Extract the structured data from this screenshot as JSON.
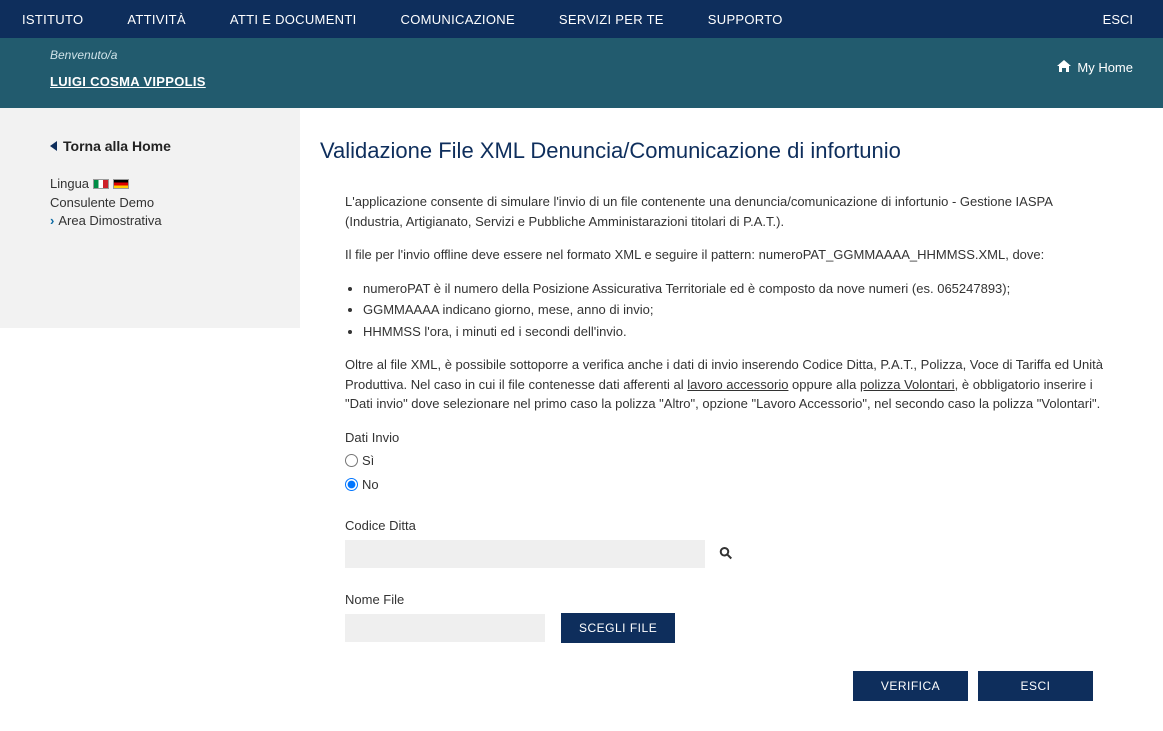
{
  "nav": {
    "items": [
      "ISTITUTO",
      "ATTIVITÀ",
      "ATTI E DOCUMENTI",
      "COMUNICAZIONE",
      "SERVIZI PER TE",
      "SUPPORTO"
    ],
    "exit": "ESCI"
  },
  "subheader": {
    "welcome": "Benvenuto/a",
    "user": "LUIGI COSMA VIPPOLIS",
    "myhome": "My Home"
  },
  "sidebar": {
    "back": "Torna alla Home",
    "lang_label": "Lingua",
    "consulente": "Consulente Demo",
    "area": "Area Dimostrativa"
  },
  "page": {
    "title": "Validazione File XML Denuncia/Comunicazione di infortunio",
    "intro1": "L'applicazione consente di simulare l'invio di un file contenente una denuncia/comunicazione di infortunio - Gestione IASPA (Industria, Artigianato, Servizi e Pubbliche Amministarazioni titolari di P.A.T.).",
    "intro2_pre": "Il file per l'invio offline deve essere nel formato XML e seguire il pattern:    ",
    "intro2_pattern": "numeroPAT_GGMMAAAA_HHMMSS.XML, dove:",
    "bullets": {
      "b1": "numeroPAT è il numero della Posizione Assicurativa Territoriale ed è composto da nove numeri (es. 065247893);",
      "b2": "GGMMAAAA indicano giorno, mese, anno di invio;",
      "b3": "HHMMSS l'ora, i minuti ed i secondi dell'invio."
    },
    "para3_a": "Oltre al file XML, è possibile sottoporre a verifica anche i dati di invio inserendo Codice Ditta, P.A.T., Polizza, Voce di Tariffa ed Unità Produttiva. Nel caso in cui il file contenesse dati afferenti al ",
    "para3_link1": "lavoro accessorio",
    "para3_b": " oppure alla ",
    "para3_link2": "polizza Volontari",
    "para3_c": ", è obbligatorio inserire i \"Dati invio\" dove selezionare nel primo caso la polizza \"Altro\", opzione \"Lavoro Accessorio\", nel secondo caso la polizza \"Volontari\".",
    "dati_invio_label": "Dati Invio",
    "radio_si": "Sì",
    "radio_no": "No",
    "codice_label": "Codice Ditta",
    "nome_label": "Nome File",
    "scegli_btn": "SCEGLI FILE",
    "verifica_btn": "VERIFICA",
    "esci_btn": "ESCI"
  }
}
